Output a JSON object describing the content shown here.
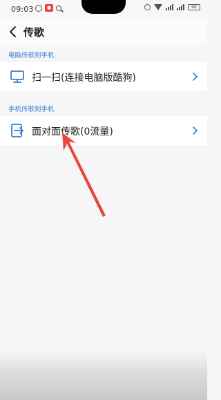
{
  "status_bar": {
    "time": "09:03",
    "battery": "90"
  },
  "header": {
    "title": "传歌"
  },
  "sections": [
    {
      "label": "电脑传歌到手机",
      "item": {
        "label": "扫一扫(连接电脑版酷狗)",
        "icon": "monitor-icon"
      }
    },
    {
      "label": "手机传歌到手机",
      "item": {
        "label": "面对面传歌(0流量)",
        "icon": "phone-transfer-icon"
      }
    }
  ],
  "colors": {
    "accent": "#3a7bd5",
    "arrow": "#e8473f"
  }
}
